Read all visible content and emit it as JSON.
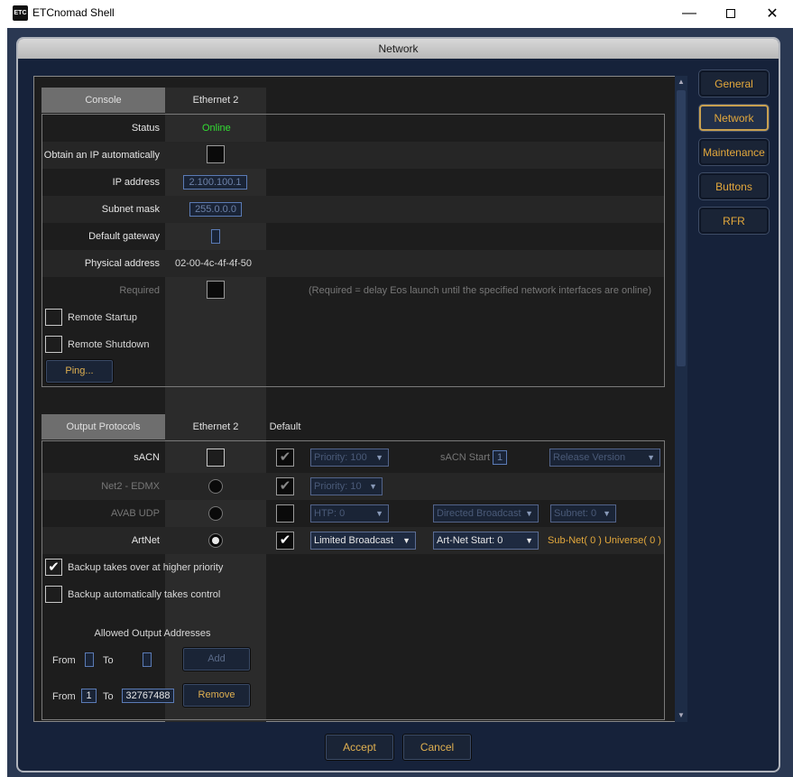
{
  "window": {
    "title": "ETCnomad Shell",
    "icon": "ETC"
  },
  "panel": {
    "title": "Network"
  },
  "sidebar": {
    "items": [
      {
        "label": "General"
      },
      {
        "label": "Network",
        "active": true
      },
      {
        "label": "Maintenance"
      },
      {
        "label": "Buttons"
      },
      {
        "label": "RFR"
      }
    ]
  },
  "console": {
    "tab_console": "Console",
    "tab_ethernet": "Ethernet 2",
    "status_label": "Status",
    "status_value": "Online",
    "obtain_ip_label": "Obtain an IP automatically",
    "ip_label": "IP address",
    "ip_value": "2.100.100.1",
    "subnet_label": "Subnet mask",
    "subnet_value": "255.0.0.0",
    "gateway_label": "Default gateway",
    "gateway_value": "",
    "mac_label": "Physical address",
    "mac_value": "02-00-4c-4f-4f-50",
    "required_label": "Required",
    "required_note": "(Required = delay Eos launch until the specified network interfaces are online)",
    "remote_startup_label": "Remote Startup",
    "remote_shutdown_label": "Remote Shutdown",
    "ping_label": "Ping..."
  },
  "output": {
    "tab_output": "Output Protocols",
    "tab_ethernet": "Ethernet 2",
    "default_label": "Default",
    "sacn": {
      "label": "sACN",
      "priority": "Priority: 100",
      "start_label": "sACN Start",
      "start_value": "1",
      "version": "Release Version"
    },
    "net2": {
      "label": "Net2 - EDMX",
      "priority": "Priority: 10"
    },
    "avab": {
      "label": "AVAB UDP",
      "htp": "HTP: 0",
      "broadcast": "Directed Broadcast",
      "subnet": "Subnet: 0"
    },
    "artnet": {
      "label": "ArtNet",
      "broadcast": "Limited Broadcast",
      "start": "Art-Net Start: 0",
      "subnet_universe": "Sub-Net( 0 ) Universe( 0 )"
    },
    "backup_priority_label": "Backup takes over at higher priority",
    "backup_auto_label": "Backup automatically takes control",
    "allowed_title": "Allowed Output Addresses",
    "from_label": "From",
    "to_label": "To",
    "row1_from": "",
    "row1_to": "",
    "add_label": "Add",
    "row2_from": "1",
    "row2_to": "32767488",
    "remove_label": "Remove"
  },
  "footer": {
    "accept_label": "Accept",
    "cancel_label": "Cancel"
  },
  "colors": {
    "accent": "#e3a83c",
    "online": "#33dd33",
    "panel_bg": "#16223a"
  }
}
